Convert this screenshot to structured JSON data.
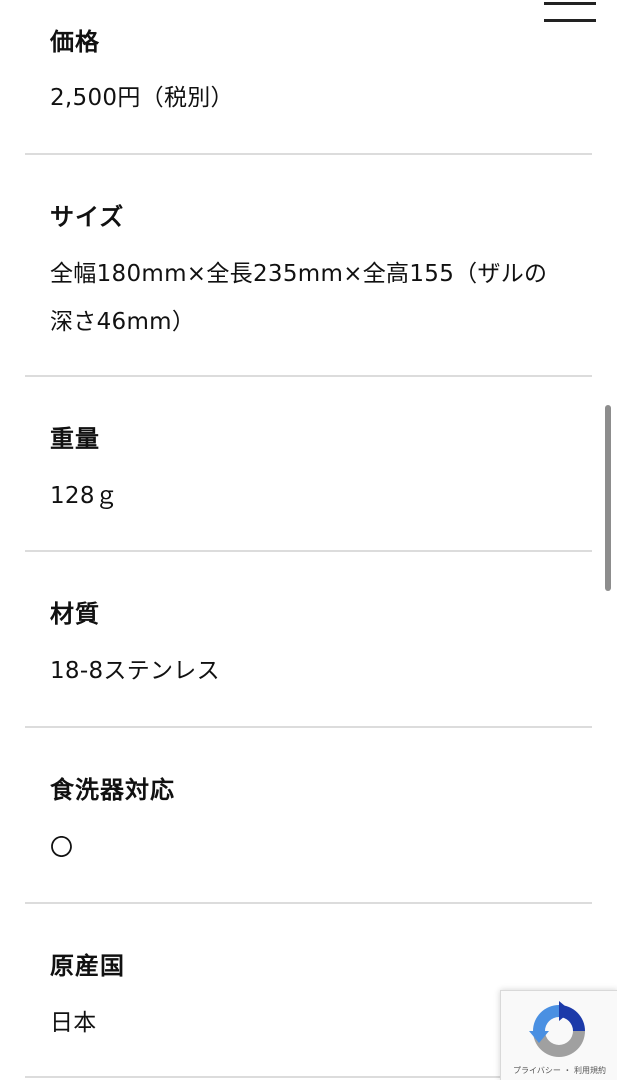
{
  "specs": [
    {
      "label": "価格",
      "value": "2,500円（税別）"
    },
    {
      "label": "サイズ",
      "value": "全幅180mm×全長235mm×全高155（ザルの深さ46mm）"
    },
    {
      "label": "重量",
      "value": "128ｇ"
    },
    {
      "label": "材質",
      "value": "18-8ステンレス"
    },
    {
      "label": "食洗器対応",
      "value": "〇"
    },
    {
      "label": "原産国",
      "value": "日本"
    }
  ],
  "header": {
    "menu_icon": "hamburger-menu-icon"
  },
  "recaptcha": {
    "logo_icon": "recaptcha-logo-icon",
    "privacy_label": "プライバシー",
    "separator": "・",
    "terms_label": "利用規約"
  },
  "colors": {
    "text": "#111111",
    "divider": "#dcdcdc",
    "scrollbar": "#8d8d8d",
    "recaptcha_blue": "#4a90e2",
    "recaptcha_dark_blue": "#1c3aa9",
    "recaptcha_gray": "#a0a0a0"
  }
}
